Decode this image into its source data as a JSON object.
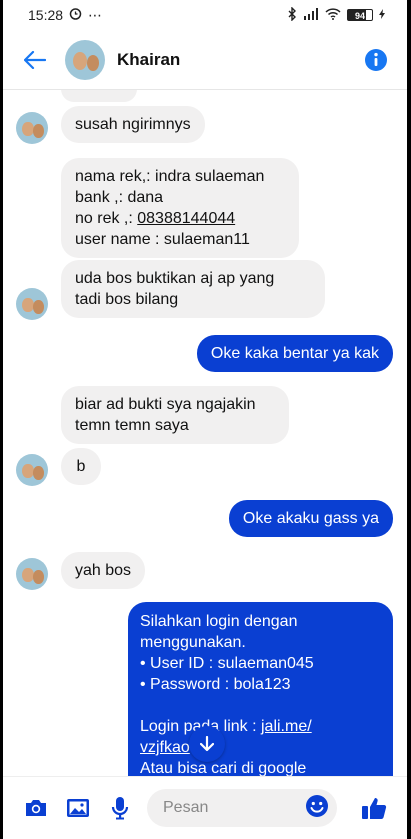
{
  "status_bar": {
    "time": "15:28",
    "battery": "94",
    "extras": "⋯"
  },
  "header": {
    "contact_name": "Khairan"
  },
  "messages": [
    {
      "text": "susah ngirimnys"
    },
    {
      "line1": "nama rek,: indra sulaeman",
      "line2": "bank ,: dana",
      "line3_prefix": "no rek ,: ",
      "line3_number": "08388144044",
      "line4": "user name : sulaeman11"
    },
    {
      "line1": "uda bos buktikan aj ap yang",
      "line2": "tadi bos bilang"
    },
    {
      "text": "Oke kaka bentar ya kak"
    },
    {
      "line1": "biar ad bukti sya ngajakin",
      "line2": "temn temn saya"
    },
    {
      "text": "b"
    },
    {
      "text": "Oke akaku gass ya"
    },
    {
      "text": "yah bos"
    },
    {
      "line1": "Silahkan login dengan",
      "line2": "menggunakan.",
      "line3": "• User ID : sulaeman045",
      "line4": "• Password : bola123",
      "line5_prefix": "Login pada link : ",
      "line5_link": "jali.me/",
      "line6_link": "vzjfkao",
      "line7": "Atau bisa cari di google"
    }
  ],
  "composer": {
    "placeholder": "Pesan"
  },
  "colors": {
    "accent": "#0a3fd2",
    "header_blue": "#1877f2",
    "incoming_bubble": "#f1f0f0"
  }
}
